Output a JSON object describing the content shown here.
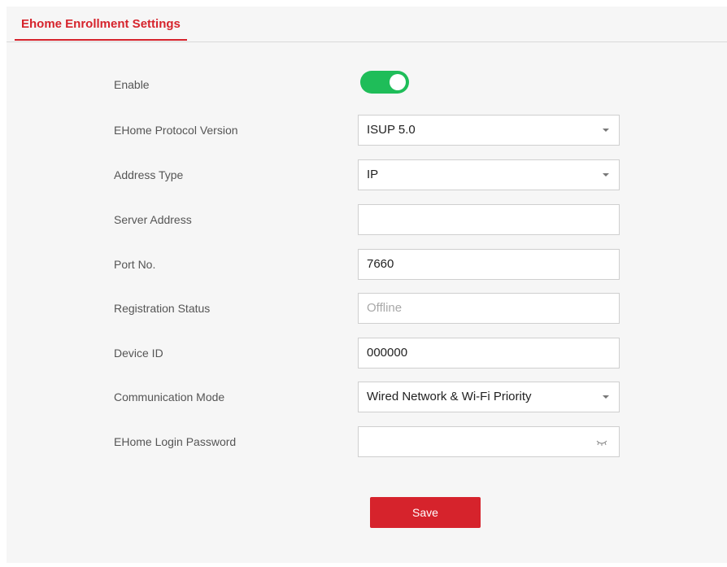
{
  "tab": {
    "label": "Ehome Enrollment Settings"
  },
  "form": {
    "enable": {
      "label": "Enable",
      "value": true
    },
    "protocol_version": {
      "label": "EHome Protocol Version",
      "value": "ISUP 5.0"
    },
    "address_type": {
      "label": "Address Type",
      "value": "IP"
    },
    "server_address": {
      "label": "Server Address",
      "value": ""
    },
    "port": {
      "label": "Port No.",
      "value": "7660"
    },
    "registration_status": {
      "label": "Registration Status",
      "value": "Offline"
    },
    "device_id": {
      "label": "Device ID",
      "value": "000000"
    },
    "communication_mode": {
      "label": "Communication Mode",
      "value": "Wired Network & Wi-Fi Priority"
    },
    "login_password": {
      "label": "EHome Login Password",
      "value": ""
    }
  },
  "save_label": "Save",
  "colors": {
    "accent": "#d6232c",
    "toggle_on": "#1fbd59",
    "panel_bg": "#f6f6f6"
  },
  "icons": {
    "dropdown": "chevron-down-icon",
    "password_visibility": "eye-closed-icon"
  }
}
